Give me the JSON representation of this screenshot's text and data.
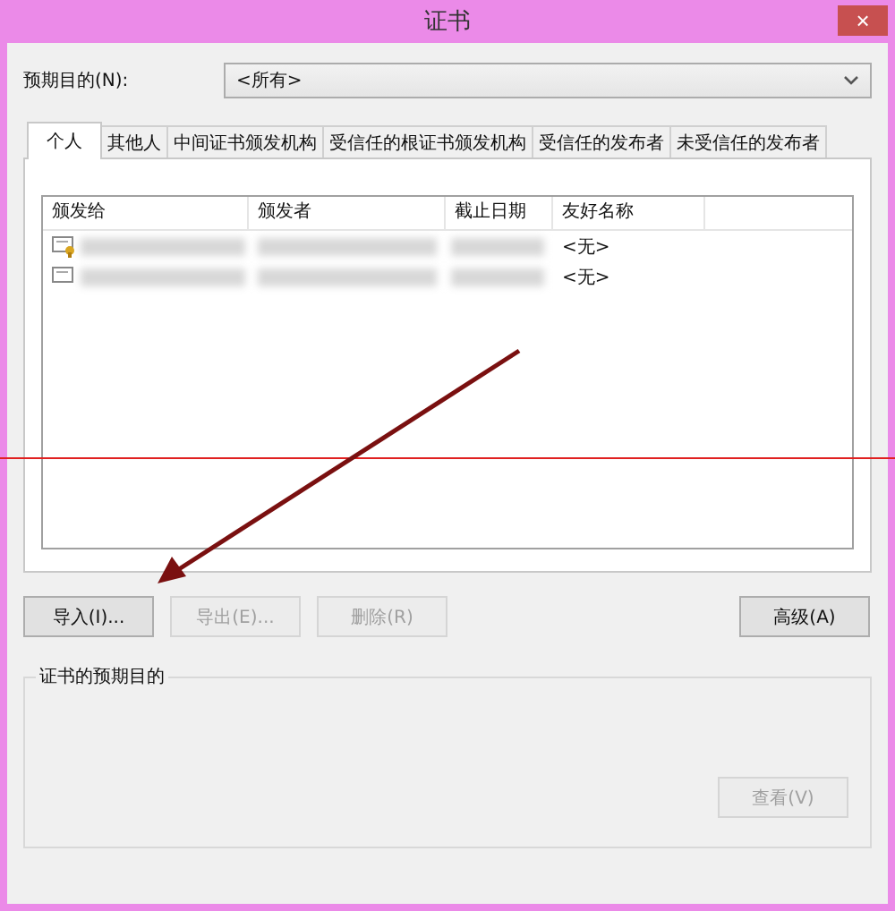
{
  "window": {
    "title": "证书",
    "close": "×"
  },
  "purpose": {
    "label": "预期目的(N):",
    "value": "<所有>"
  },
  "tabs": [
    {
      "label": "个人",
      "selected": true
    },
    {
      "label": "其他人",
      "selected": false
    },
    {
      "label": "中间证书颁发机构",
      "selected": false
    },
    {
      "label": "受信任的根证书颁发机构",
      "selected": false
    },
    {
      "label": "受信任的发布者",
      "selected": false
    },
    {
      "label": "未受信任的发布者",
      "selected": false
    }
  ],
  "table": {
    "columns": [
      "颁发给",
      "颁发者",
      "截止日期",
      "友好名称"
    ],
    "rows": [
      {
        "friendly_name": "<无>",
        "has_key": true
      },
      {
        "friendly_name": "<无>",
        "has_key": false
      }
    ]
  },
  "buttons": [
    {
      "label": "导入(I)...",
      "disabled": false
    },
    {
      "label": "导出(E)...",
      "disabled": true
    },
    {
      "label": "删除(R)",
      "disabled": true
    }
  ],
  "advanced_button": {
    "label": "高级(A)",
    "disabled": false
  },
  "group": {
    "title": "证书的预期目的",
    "view_button": {
      "label": "查看(V)",
      "disabled": true
    }
  }
}
